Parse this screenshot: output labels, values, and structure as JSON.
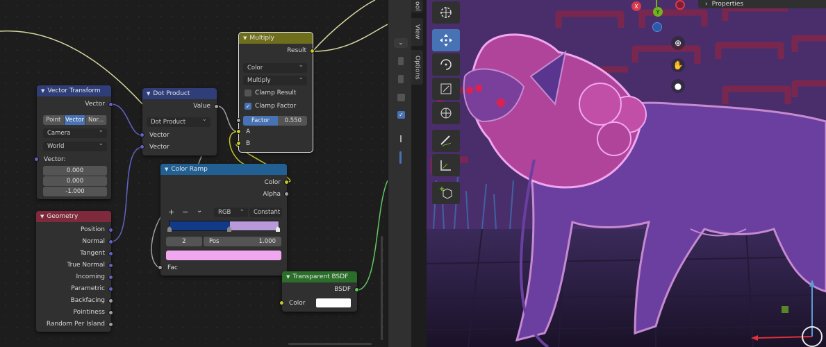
{
  "nodes": {
    "multiply": {
      "title": "Multiply",
      "output_result": "Result",
      "data_type": "Color",
      "blend_mode": "Multiply",
      "clamp_result": "Clamp Result",
      "clamp_factor": "Clamp Factor",
      "factor_label": "Factor",
      "factor_value": "0.550",
      "input_a": "A",
      "input_b": "B"
    },
    "vector_transform": {
      "title": "Vector Transform",
      "output_vector": "Vector",
      "type_options": [
        "Point",
        "Vector",
        "Nor..."
      ],
      "convert_from": "Camera",
      "convert_to": "World",
      "input_label": "Vector:",
      "values": [
        "0.000",
        "0.000",
        "-1.000"
      ]
    },
    "dot_product": {
      "title": "Dot Product",
      "output_value": "Value",
      "operation": "Dot Product",
      "input_1": "Vector",
      "input_2": "Vector"
    },
    "color_ramp": {
      "title": "Color Ramp",
      "output_color": "Color",
      "output_alpha": "Alpha",
      "add_symbol": "+",
      "remove_symbol": "−",
      "menu_symbol": "⌄",
      "color_mode": "RGB",
      "interpolation": "Constant",
      "stop_index": "2",
      "pos_label": "Pos",
      "pos_value": "1.000",
      "input_fac": "Fac"
    },
    "geometry": {
      "title": "Geometry",
      "outputs": [
        "Position",
        "Normal",
        "Tangent",
        "True Normal",
        "Incoming",
        "Parametric",
        "Backfacing",
        "Pointiness",
        "Random Per Island"
      ]
    },
    "transparent_bsdf": {
      "title": "Transparent BSDF",
      "output_bsdf": "BSDF",
      "input_color": "Color"
    }
  },
  "sidebar_tabs": [
    "ool",
    "View",
    "Options"
  ],
  "viewport": {
    "properties_title": "Properties",
    "gizmo_x": "X",
    "gizmo_y": "Y"
  },
  "colors": {
    "multiply_header": "#6e6e1d",
    "vector_header": "#2f3e78",
    "color_ramp_header": "#226094",
    "geometry_header": "#7f2a3c",
    "shader_header": "#2a6e2a",
    "ramp_color1": "#123a88",
    "ramp_color2": "#b89ad8",
    "ramp_result": "#f0a7f0"
  }
}
